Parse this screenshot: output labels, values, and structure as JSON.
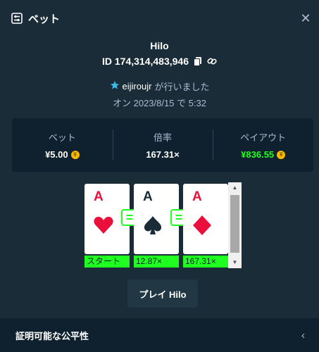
{
  "header": {
    "title": "ベット",
    "icon": "bet-slip-icon",
    "close_icon": "close-icon",
    "close_glyph": "✕"
  },
  "game": {
    "name": "Hilo"
  },
  "bet": {
    "id": "ID 174,314,483,946",
    "copy_icon": "copy-icon",
    "link_icon": "link-icon"
  },
  "user": {
    "icon": "vip-star-icon",
    "name": "eijiroujr",
    "suffix": "が行いました"
  },
  "date": {
    "text": "オン 2023/8/15 で 5:32"
  },
  "stats": {
    "bet": {
      "label": "ベット",
      "value": "¥5.00"
    },
    "multiplier": {
      "label": "倍率",
      "value": "167.31×"
    },
    "payout": {
      "label": "ペイアウト",
      "value": "¥836.55"
    },
    "coin_icon": "yen-coin-icon",
    "coin_glyph": "¥"
  },
  "cards": [
    {
      "rank": "A",
      "suit": "hearts",
      "color": "#e9113c",
      "tag": "スタート"
    },
    {
      "rank": "A",
      "suit": "spades",
      "color": "#1a2c38",
      "tag": "12.87×"
    },
    {
      "rank": "A",
      "suit": "diamonds",
      "color": "#e9113c",
      "tag": "167.31×"
    }
  ],
  "equal_glyph": "=",
  "play_button": {
    "label": "プレイ Hilo"
  },
  "footer": {
    "title": "証明可能な公平性",
    "chevron": "‹"
  },
  "colors": {
    "background": "#1a2c38",
    "panel": "#0f212e",
    "accent_green": "#1fff20",
    "red": "#e9113c"
  }
}
